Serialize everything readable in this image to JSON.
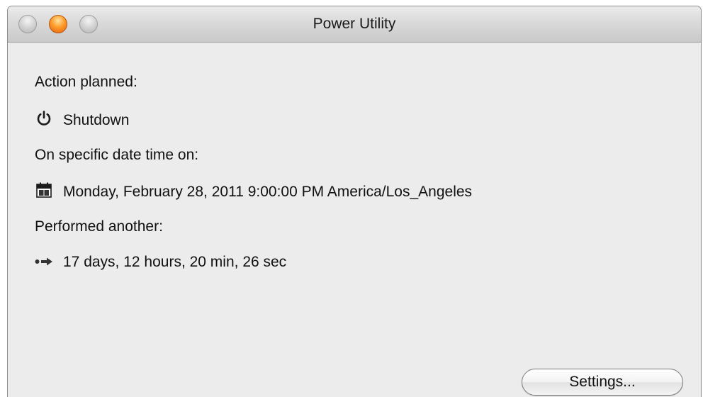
{
  "window": {
    "title": "Power Utility",
    "controls": [
      "close",
      "minimize",
      "zoom"
    ]
  },
  "action": {
    "label": "Action planned:",
    "icon": "power-icon",
    "value": "Shutdown"
  },
  "schedule": {
    "label": "On specific date time on:",
    "icon": "calendar-icon",
    "value": "Monday, February 28, 2011 9:00:00 PM America/Los_Angeles"
  },
  "countdown": {
    "label": "Performed another:",
    "icon": "arrow-right-icon",
    "value": "17 days, 12 hours, 20 min, 26 sec"
  },
  "buttons": {
    "settings_label": "Settings..."
  },
  "colors": {
    "minimize_button": "#ff9c2a",
    "window_background": "#ececec"
  }
}
